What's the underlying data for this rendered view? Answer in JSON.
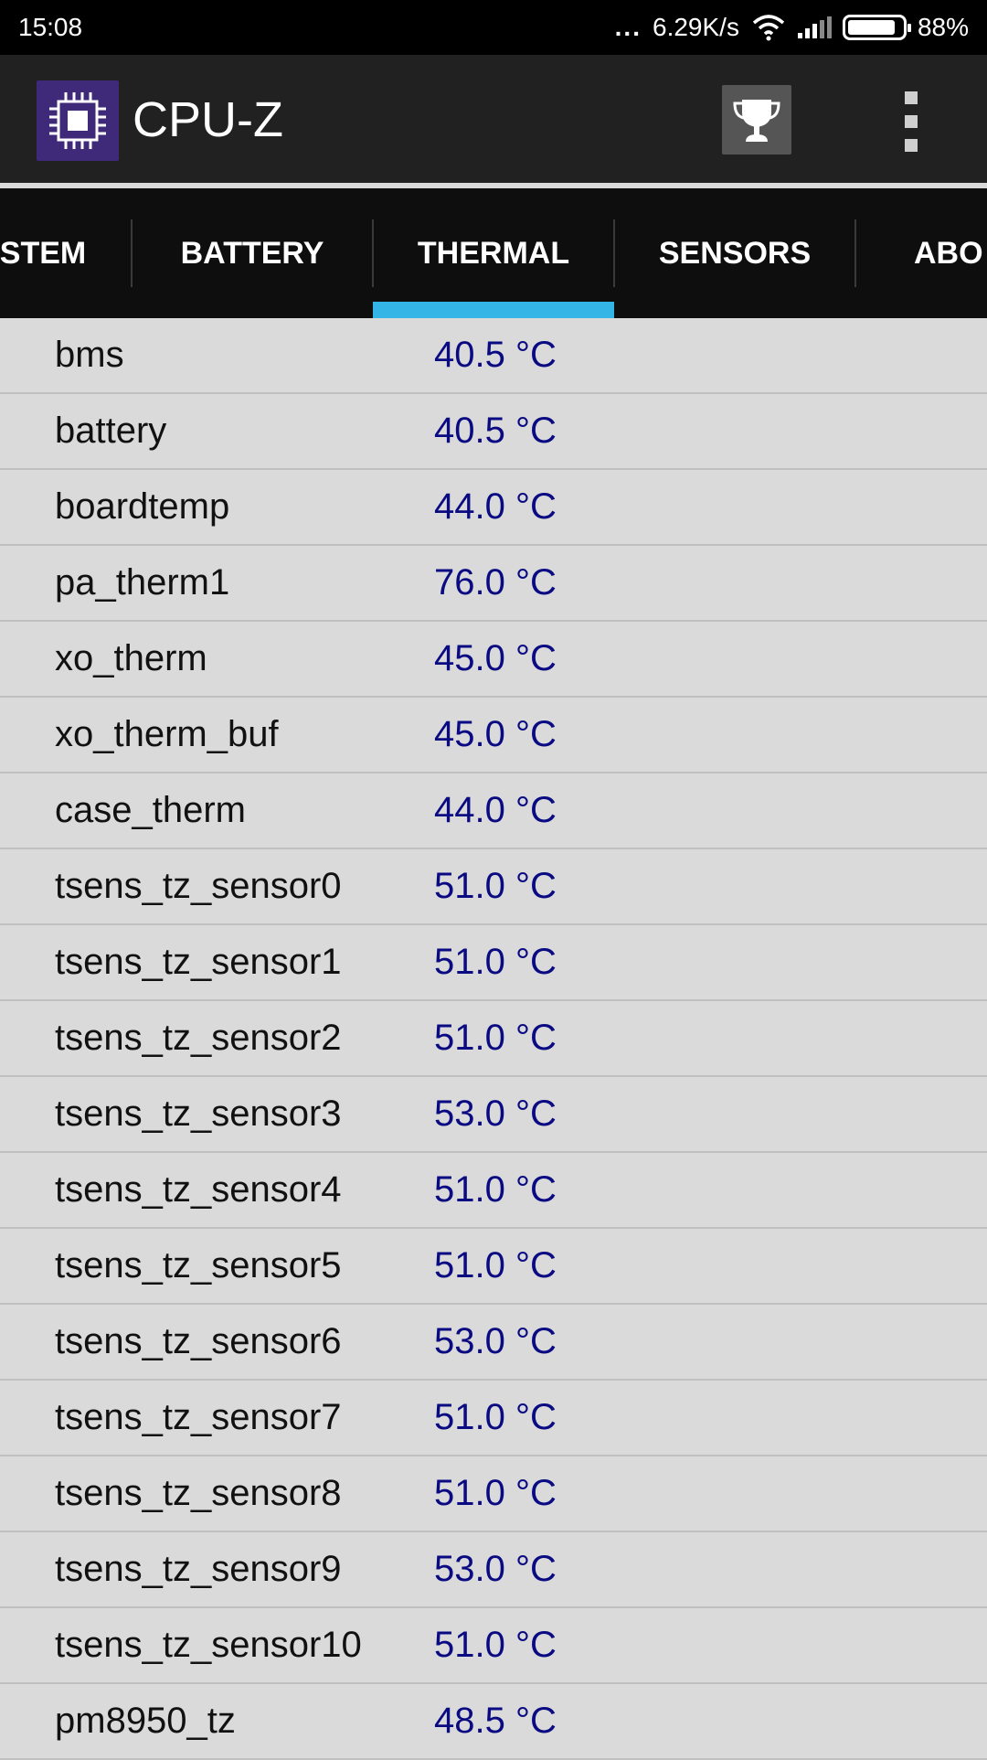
{
  "status_bar": {
    "time": "15:08",
    "dots": "...",
    "net_speed": "6.29K/s",
    "battery_percent": "88%",
    "battery_level": 0.88,
    "icons": [
      "wifi-icon",
      "signal-icon",
      "battery-icon"
    ]
  },
  "app_bar": {
    "title": "CPU-Z",
    "icons": [
      "cpu-chip-icon",
      "trophy-icon",
      "overflow-menu-icon"
    ]
  },
  "tabs": [
    {
      "label": "STEM",
      "selected": false
    },
    {
      "label": "BATTERY",
      "selected": false
    },
    {
      "label": "THERMAL",
      "selected": true
    },
    {
      "label": "SENSORS",
      "selected": false
    },
    {
      "label": "ABO",
      "selected": false
    }
  ],
  "colors": {
    "accent": "#33b5e5",
    "value_text": "#0a0a82",
    "list_background": "#dadada",
    "app_bar": "#212121"
  },
  "thermal": [
    {
      "name": "bms",
      "value": "40.5 °C"
    },
    {
      "name": "battery",
      "value": "40.5 °C"
    },
    {
      "name": "boardtemp",
      "value": "44.0 °C"
    },
    {
      "name": "pa_therm1",
      "value": "76.0 °C"
    },
    {
      "name": "xo_therm",
      "value": "45.0 °C"
    },
    {
      "name": "xo_therm_buf",
      "value": "45.0 °C"
    },
    {
      "name": "case_therm",
      "value": "44.0 °C"
    },
    {
      "name": "tsens_tz_sensor0",
      "value": "51.0 °C"
    },
    {
      "name": "tsens_tz_sensor1",
      "value": "51.0 °C"
    },
    {
      "name": "tsens_tz_sensor2",
      "value": "51.0 °C"
    },
    {
      "name": "tsens_tz_sensor3",
      "value": "53.0 °C"
    },
    {
      "name": "tsens_tz_sensor4",
      "value": "51.0 °C"
    },
    {
      "name": "tsens_tz_sensor5",
      "value": "51.0 °C"
    },
    {
      "name": "tsens_tz_sensor6",
      "value": "53.0 °C"
    },
    {
      "name": "tsens_tz_sensor7",
      "value": "51.0 °C"
    },
    {
      "name": "tsens_tz_sensor8",
      "value": "51.0 °C"
    },
    {
      "name": "tsens_tz_sensor9",
      "value": "53.0 °C"
    },
    {
      "name": "tsens_tz_sensor10",
      "value": "51.0 °C"
    },
    {
      "name": "pm8950_tz",
      "value": "48.5 °C"
    }
  ]
}
